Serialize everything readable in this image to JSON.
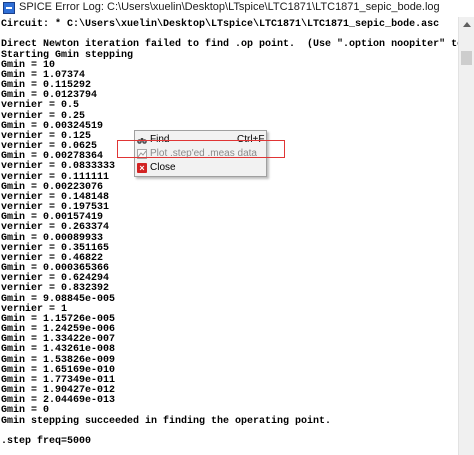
{
  "window": {
    "title": "SPICE Error Log: C:\\Users\\xuelin\\Desktop\\LTspice\\LTC1871\\LTC1871_sepic_bode.log"
  },
  "log": {
    "lines": [
      "Circuit: * C:\\Users\\xuelin\\Desktop\\LTspice\\LTC1871\\LTC1871_sepic_bode.asc",
      "",
      "Direct Newton iteration failed to find .op point.  (Use \".option noopiter\" to skip.)",
      "Starting Gmin stepping",
      "Gmin = 10",
      "Gmin = 1.07374",
      "Gmin = 0.115292",
      "Gmin = 0.0123794",
      "vernier = 0.5",
      "vernier = 0.25",
      "Gmin = 0.00324519",
      "vernier = 0.125",
      "vernier = 0.0625",
      "Gmin = 0.00278364",
      "vernier = 0.0833333",
      "vernier = 0.111111",
      "Gmin = 0.00223076",
      "vernier = 0.148148",
      "vernier = 0.197531",
      "Gmin = 0.00157419",
      "vernier = 0.263374",
      "Gmin = 0.00089933",
      "vernier = 0.351165",
      "vernier = 0.46822",
      "Gmin = 0.000365366",
      "vernier = 0.624294",
      "vernier = 0.832392",
      "Gmin = 9.08845e-005",
      "vernier = 1",
      "Gmin = 1.15726e-005",
      "Gmin = 1.24259e-006",
      "Gmin = 1.33422e-007",
      "Gmin = 1.43261e-008",
      "Gmin = 1.53826e-009",
      "Gmin = 1.65169e-010",
      "Gmin = 1.77349e-011",
      "Gmin = 1.90427e-012",
      "Gmin = 2.04469e-013",
      "Gmin = 0",
      "Gmin stepping succeeded in finding the operating point.",
      "",
      ".step freq=5000"
    ]
  },
  "context_menu": {
    "items": [
      {
        "label": "Find",
        "shortcut": "Ctrl+F",
        "icon": "binoculars-icon",
        "enabled": true
      },
      {
        "label": "Plot .step'ed .meas data",
        "shortcut": "",
        "icon": "chart-icon",
        "enabled": false
      },
      {
        "label": "Close",
        "shortcut": "",
        "icon": "close-icon",
        "enabled": true
      }
    ]
  },
  "colors": {
    "highlight": "#e03535",
    "text": "#000000",
    "disabled_text": "#8a8a8a"
  }
}
